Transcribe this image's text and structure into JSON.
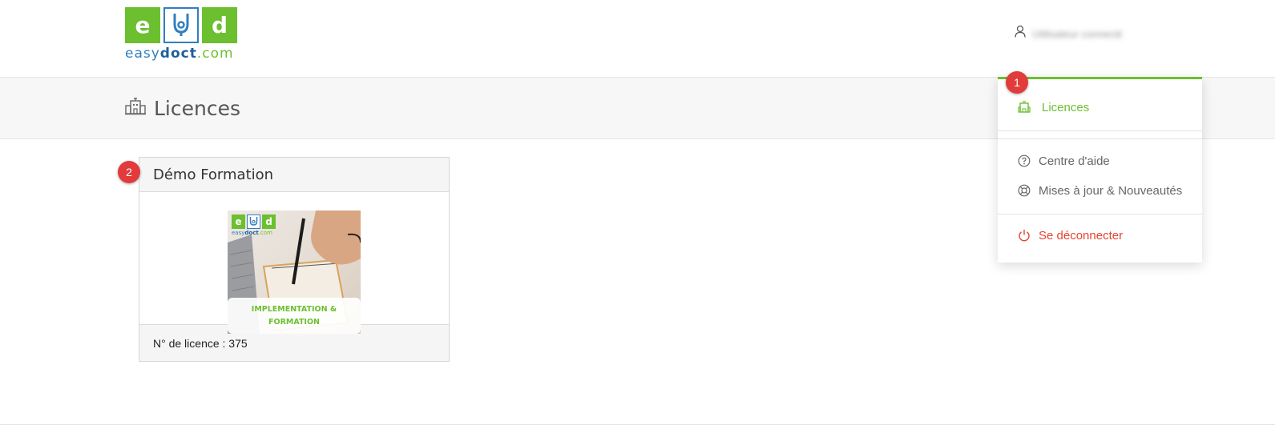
{
  "header": {
    "logo": {
      "tile_left": "e",
      "tile_right": "d",
      "text_easy": "easy",
      "text_doct": "doct",
      "text_com": ".com"
    },
    "user_name": "Utilisateur connecté",
    "user_icon": "user-icon"
  },
  "page": {
    "title": "Licences",
    "title_icon": "building-icon"
  },
  "license_card": {
    "title": "Démo Formation",
    "image_caption": "IMPLEMENTATION & FORMATION",
    "license_number_text": "N° de licence : 375"
  },
  "user_menu": {
    "items": [
      {
        "label": "Licences",
        "icon": "building-icon"
      },
      {
        "label": "Centre d'aide",
        "icon": "help-circle-icon"
      },
      {
        "label": "Mises à jour & Nouveautés",
        "icon": "lifebuoy-icon"
      },
      {
        "label": "Se déconnecter",
        "icon": "power-icon"
      }
    ]
  },
  "annotations": [
    "1",
    "2"
  ],
  "colors": {
    "brand_green": "#6cbf2f",
    "brand_blue": "#2f7fc1",
    "logout_red": "#e8432e",
    "badge_red": "#e23b3b"
  }
}
